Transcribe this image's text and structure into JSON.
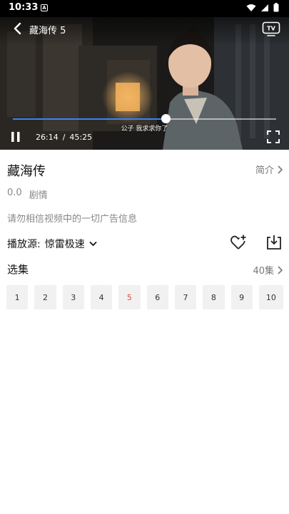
{
  "status_bar": {
    "time": "10:33",
    "badge": "A"
  },
  "player": {
    "title": "藏海传 5",
    "subtitle": "公子 我求求你了",
    "current_time": "26:14",
    "separator": "/",
    "duration": "45:25",
    "progress": 0.58,
    "accent_color": "#3b82f6",
    "cast_icon": "tv-cast-icon"
  },
  "info": {
    "title": "藏海传",
    "intro_label": "简介",
    "rating": "0.0",
    "genre": "剧情",
    "notice": "请勿相信视频中的一切广告信息"
  },
  "source": {
    "label": "播放源:",
    "value": "惊雷极速"
  },
  "episodes": {
    "title": "选集",
    "count_label": "40集",
    "items": [
      "1",
      "2",
      "3",
      "4",
      "5",
      "6",
      "7",
      "8",
      "9",
      "10"
    ],
    "selected": "5",
    "selected_color": "#e04a3a"
  }
}
